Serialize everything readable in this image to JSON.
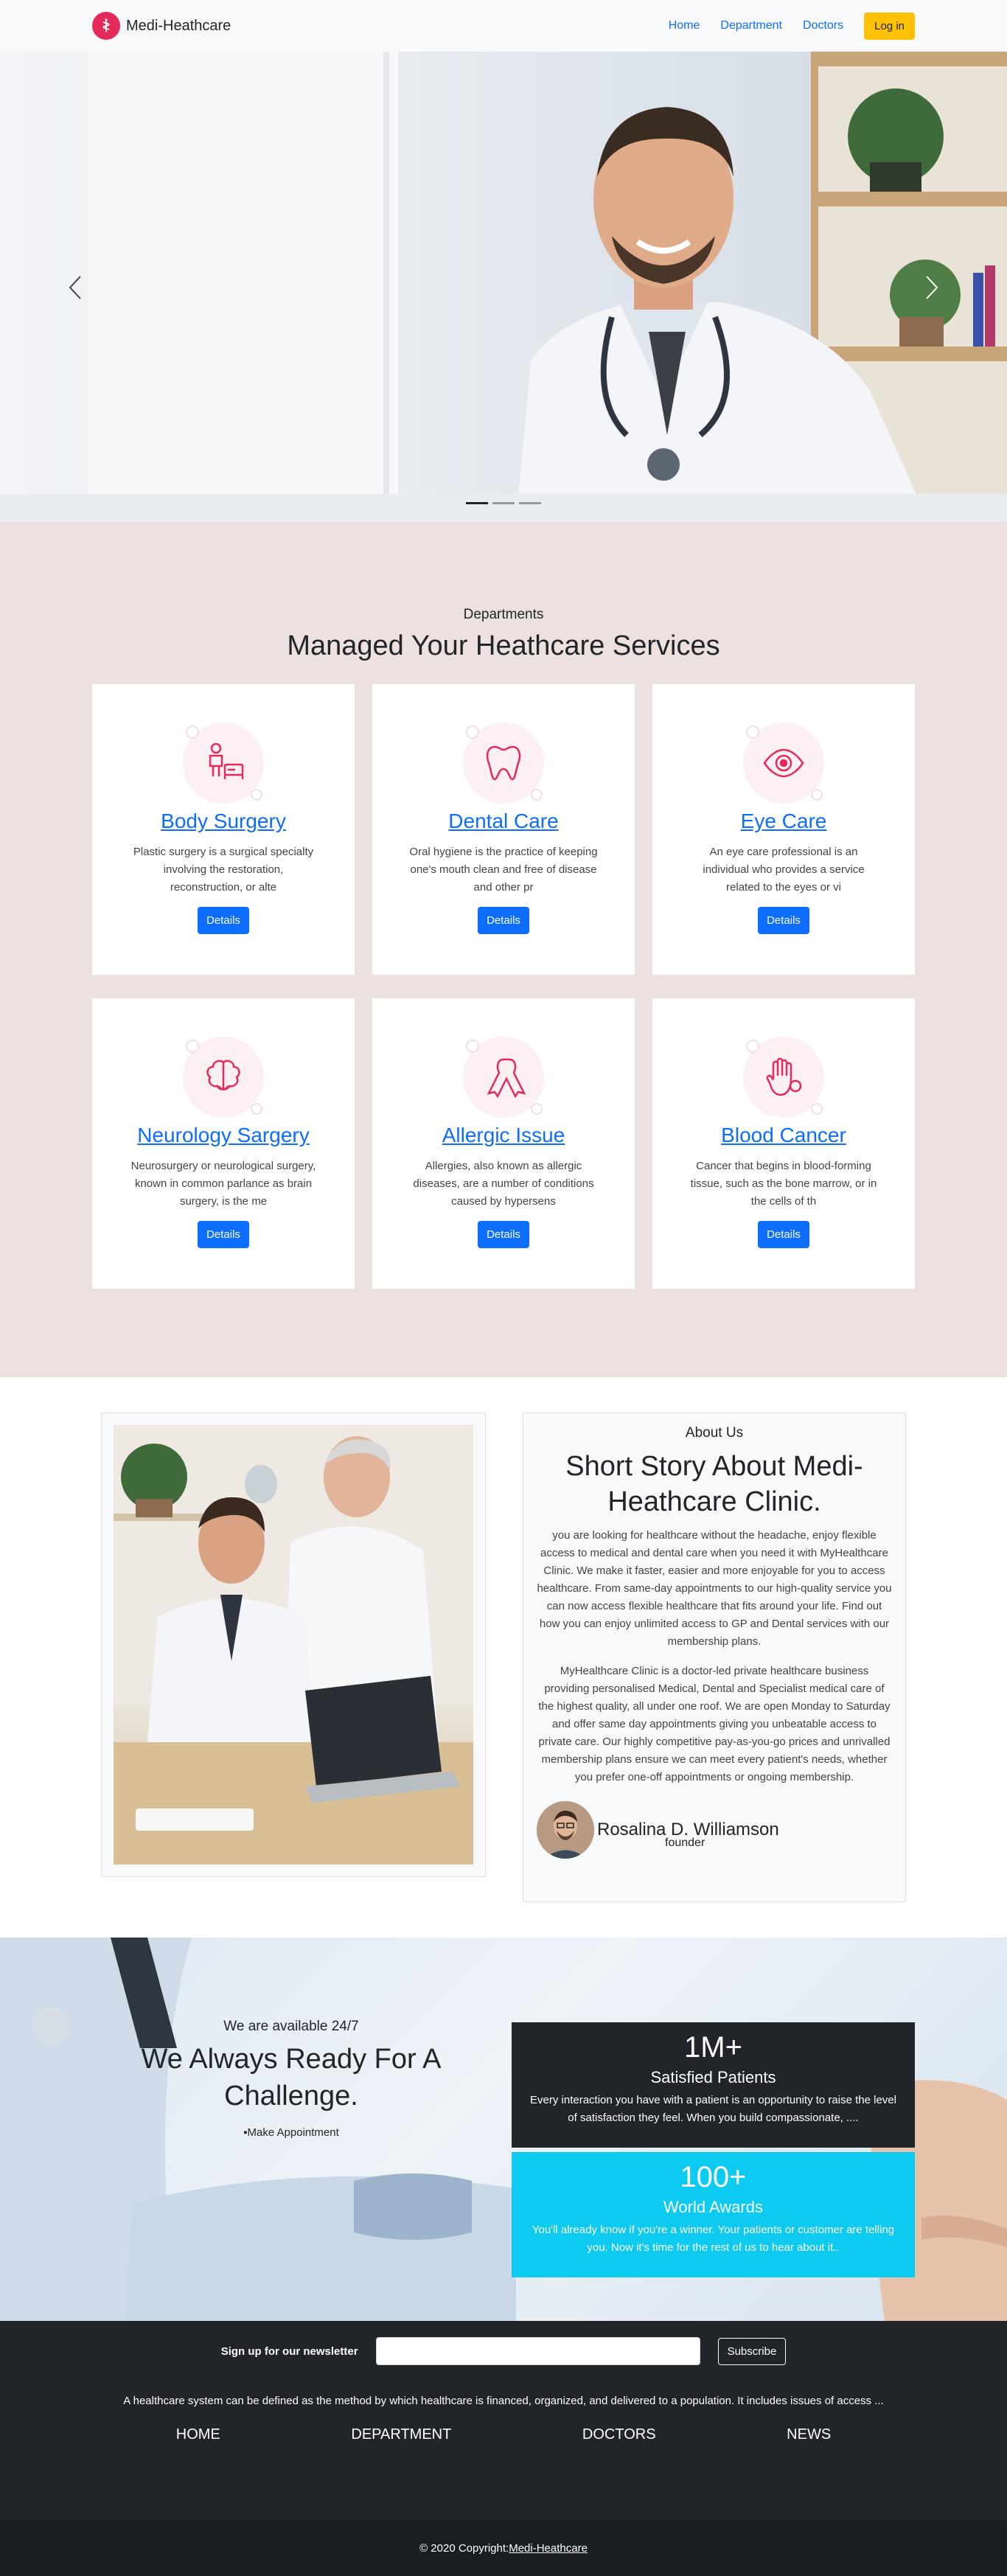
{
  "navbar": {
    "brand": "Medi-Heathcare",
    "links": [
      "Home",
      "Department",
      "Doctors"
    ],
    "login": "Log in"
  },
  "hero": {
    "active_slide": 1,
    "slide_count": 3
  },
  "departments": {
    "kicker": "Departments",
    "title": "Managed Your Heathcare Services",
    "cards": [
      {
        "name": "Body Surgery",
        "desc": "Plastic surgery is a surgical specialty involving the restoration, reconstruction, or alte",
        "button": "Details",
        "icon": "surgery-bed-icon"
      },
      {
        "name": "Dental Care",
        "desc": "Oral hygiene is the practice of keeping one's mouth clean and free of disease and other pr",
        "button": "Details",
        "icon": "tooth-icon"
      },
      {
        "name": "Eye Care",
        "desc": "An eye care professional is an individual who provides a service related to the eyes or vi",
        "button": "Details",
        "icon": "eye-icon"
      },
      {
        "name": "Neurology Sargery",
        "desc": "Neurosurgery or neurological surgery, known in common parlance as brain surgery, is the me",
        "button": "Details",
        "icon": "brain-icon"
      },
      {
        "name": "Allergic Issue",
        "desc": "Allergies, also known as allergic diseases, are a number of conditions caused by hypersens",
        "button": "Details",
        "icon": "ribbon-icon"
      },
      {
        "name": "Blood Cancer",
        "desc": "Cancer that begins in blood-forming tissue, such as the bone marrow, or in the cells of th",
        "button": "Details",
        "icon": "hand-virus-icon"
      }
    ]
  },
  "about": {
    "kicker": "About Us",
    "title": "Short Story About Medi-Heathcare Clinic.",
    "p1": "you are looking for healthcare without the headache, enjoy flexible access to medical and dental care when you need it with MyHealthcare Clinic. We make it faster, easier and more enjoyable for you to access healthcare. From same-day appointments to our high-quality service you can now access flexible healthcare that fits around your life. Find out how you can enjoy unlimited access to GP and Dental services with our membership plans.",
    "p2": "MyHealthcare Clinic is a doctor-led private healthcare business providing personalised Medical, Dental and Specialist medical care of the highest quality, all under one roof. We are open Monday to Saturday and offer same day appointments giving you unbeatable access to private care. Our highly competitive pay-as-you-go prices and unrivalled membership plans ensure we can meet every patient's needs, whether you prefer one-off appointments or ongoing membership.",
    "founder_name": "Rosalina D. Williamson",
    "founder_role": "founder"
  },
  "available": {
    "kicker": "We are available 24/7",
    "title": "We Always Ready For A Challenge.",
    "link": "Make Appointment",
    "stats": [
      {
        "number": "1M+",
        "label": "Satisfied Patients",
        "desc": "Every interaction you have with a patient is an opportunity to raise the level of satisfaction they feel. When you build compassionate, ...."
      },
      {
        "number": "100+",
        "label": "World Awards",
        "desc": "You'll already know if you're a winner. Your patients or customer are telling you. Now it's time for the rest of us to hear about it.."
      }
    ]
  },
  "footer": {
    "newsletter_label": "Sign up for our newsletter",
    "subscribe": "Subscribe",
    "desc": "A healthcare system can be defined as the method by which healthcare is financed, organized, and delivered to a population. It includes issues of access ...",
    "nav": [
      "HOME",
      "DEPARTMENT",
      "DOCTORS",
      "NEWS"
    ],
    "copyright_prefix": "© 2020 Copyright:",
    "copyright_link": " Medi-Heathcare"
  }
}
